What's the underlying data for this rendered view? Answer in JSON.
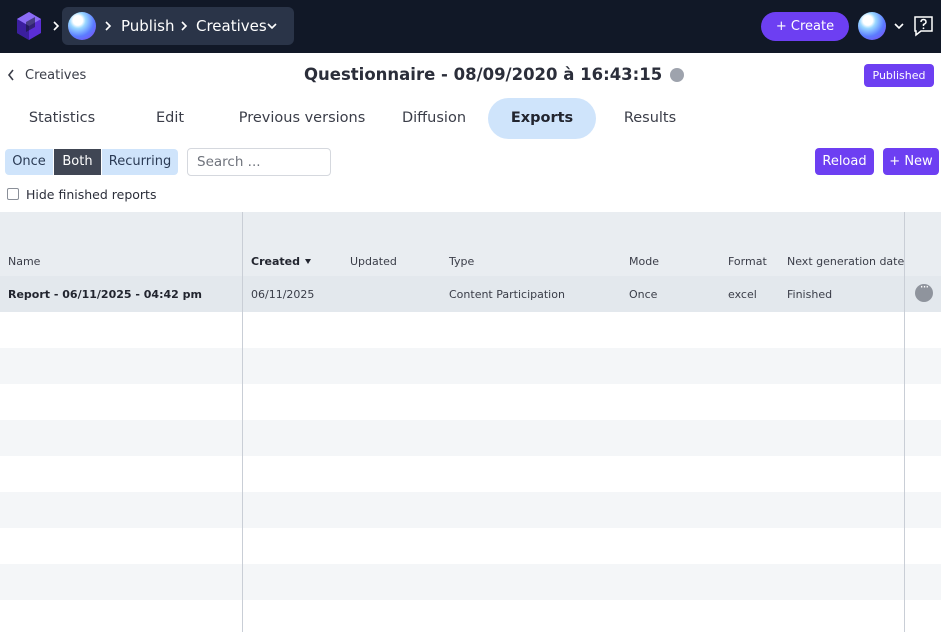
{
  "topbar": {
    "breadcrumb": [
      "Publish",
      "Creatives"
    ],
    "create_label": "+ Create"
  },
  "header": {
    "back_label": "Creatives",
    "title": "Questionnaire - 08/09/2020 à 16:43:15",
    "status": "Published"
  },
  "tabs": [
    {
      "label": "Statistics",
      "active": false
    },
    {
      "label": "Edit",
      "active": false
    },
    {
      "label": "Previous versions",
      "active": false
    },
    {
      "label": "Diffusion",
      "active": false
    },
    {
      "label": "Exports",
      "active": true
    },
    {
      "label": "Results",
      "active": false
    }
  ],
  "filters": {
    "segments": [
      "Once",
      "Both",
      "Recurring"
    ],
    "selected": "Both",
    "search_placeholder": "Search ...",
    "reload_label": "Reload",
    "new_label": "+ New",
    "hide_finished_label": "Hide finished reports",
    "hide_finished_checked": false
  },
  "table": {
    "columns": [
      "Name",
      "Created",
      "Updated",
      "Type",
      "Mode",
      "Format",
      "Next generation date"
    ],
    "sorted_column": "Created",
    "rows": [
      {
        "name": "Report - 06/11/2025 - 04:42 pm",
        "created": "06/11/2025",
        "updated": "",
        "type": "Content Participation",
        "mode": "Once",
        "format": "excel",
        "next_generation": "Finished"
      }
    ]
  },
  "colors": {
    "topbar": "#111827",
    "accent": "#6d3ff2",
    "tab_active_bg": "#cfe4fb",
    "segment_selected": "#404654"
  }
}
